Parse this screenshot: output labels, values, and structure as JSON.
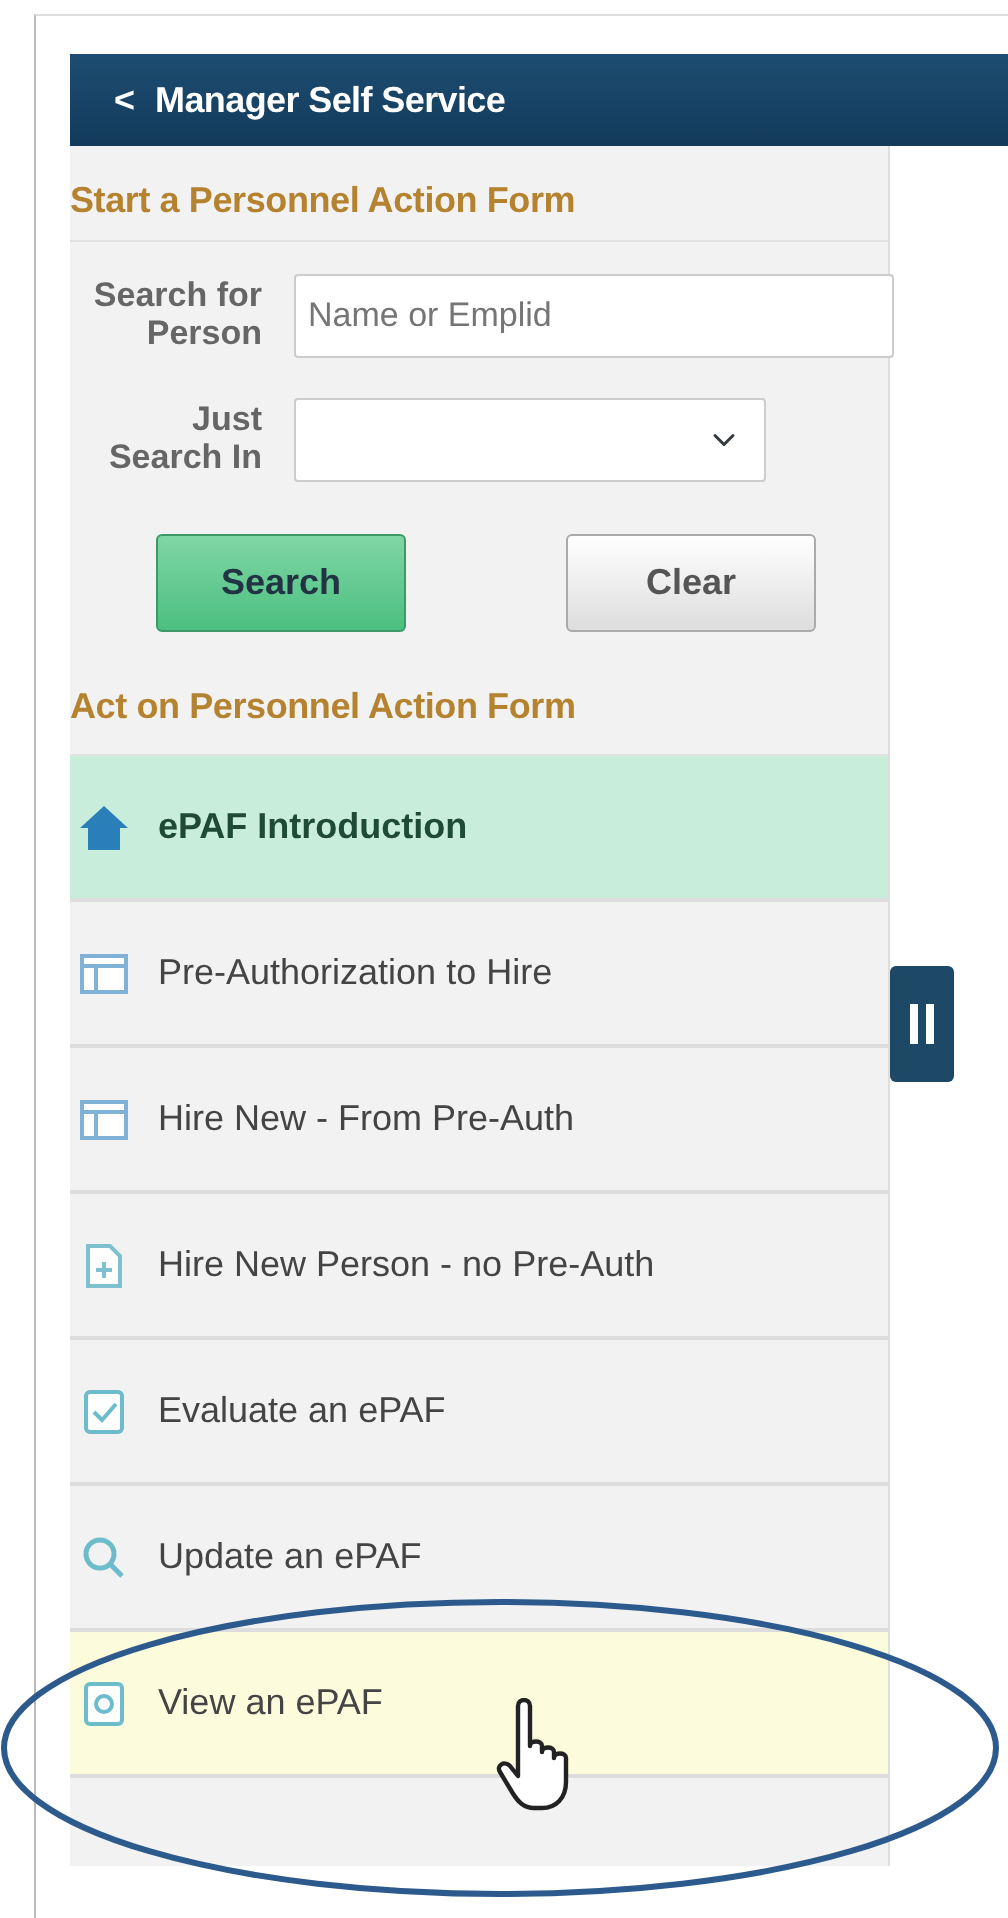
{
  "header": {
    "back_icon": "<",
    "title": "Manager Self Service"
  },
  "start_form": {
    "heading": "Start a Personnel Action Form",
    "search_label": "Search for Person",
    "search_placeholder": "Name or Emplid",
    "just_label": "Just Search In",
    "buttons": [
      {
        "label": "Search",
        "kind": "primary"
      },
      {
        "label": "Clear",
        "kind": "secondary"
      }
    ]
  },
  "act_form": {
    "heading": "Act on Personnel Action Form",
    "items": [
      {
        "label": "ePAF Introduction",
        "kind": "home",
        "selected": true,
        "hovered": false
      },
      {
        "label": "Pre-Authorization to Hire",
        "kind": "panel",
        "selected": false,
        "hovered": false
      },
      {
        "label": "Hire New - From Pre-Auth",
        "kind": "panel",
        "selected": false,
        "hovered": false
      },
      {
        "label": "Hire New Person - no Pre-Auth",
        "kind": "add-doc",
        "selected": false,
        "hovered": false
      },
      {
        "label": "Evaluate an ePAF",
        "kind": "check-doc",
        "selected": false,
        "hovered": false
      },
      {
        "label": "Update an ePAF",
        "kind": "search",
        "selected": false,
        "hovered": false
      },
      {
        "label": "View an ePAF",
        "kind": "view-doc",
        "selected": false,
        "hovered": true
      }
    ]
  }
}
